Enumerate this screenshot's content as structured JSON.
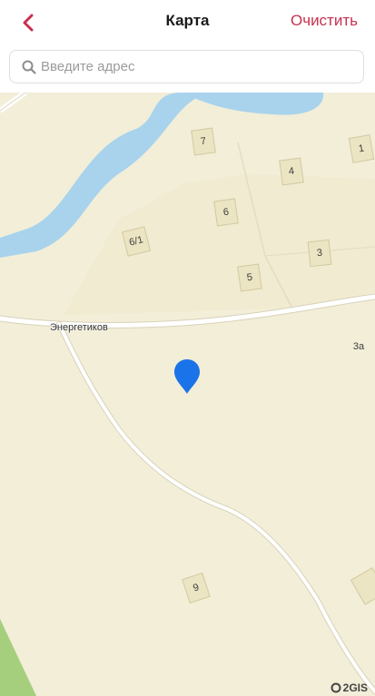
{
  "header": {
    "title": "Карта",
    "clear_label": "Очистить",
    "accent_color": "#c6314f"
  },
  "search": {
    "placeholder": "Введите адрес",
    "value": ""
  },
  "map": {
    "street_label": "Энергетиков",
    "buildings": [
      "7",
      "1",
      "4",
      "6",
      "6/1",
      "3",
      "5",
      "3а",
      "9"
    ],
    "water_color": "#a9d3ec",
    "attribution": "2GIS",
    "marker_color": "#1a73e8"
  }
}
